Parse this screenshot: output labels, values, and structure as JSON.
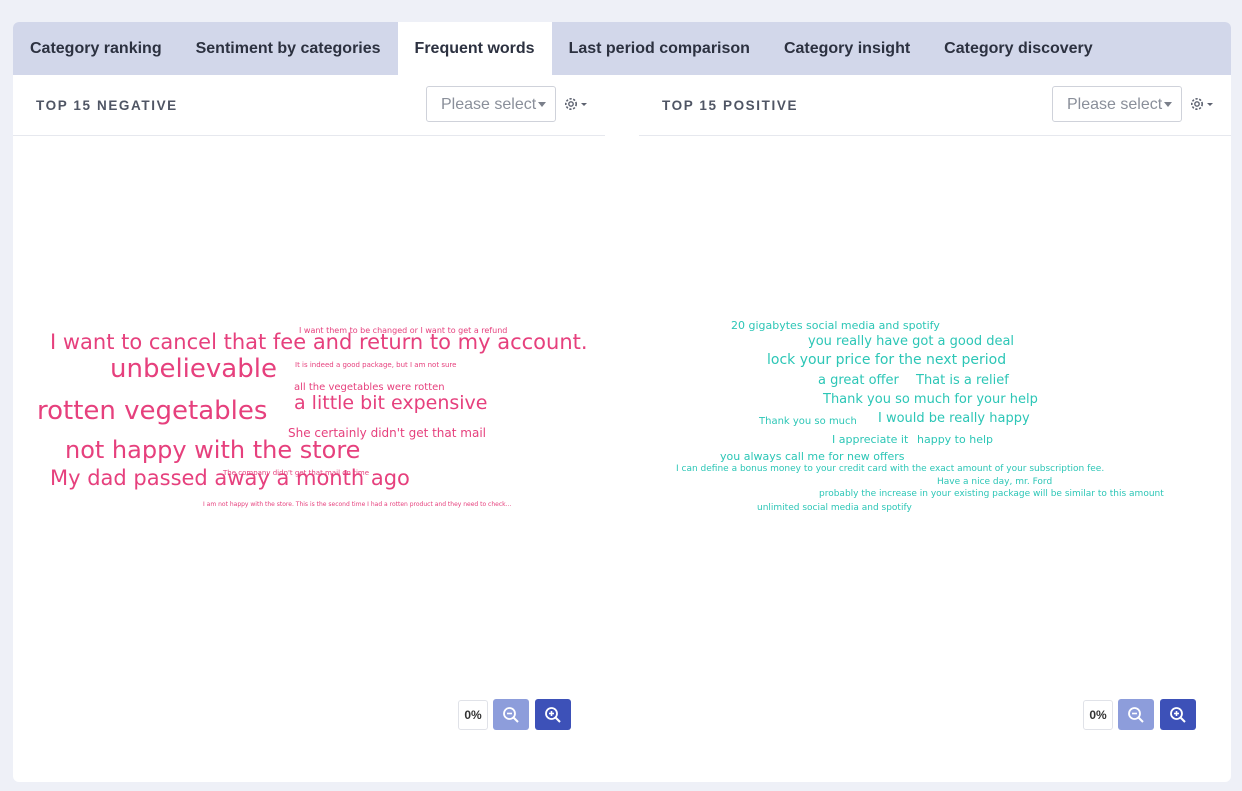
{
  "tabs": [
    {
      "label": "Category ranking"
    },
    {
      "label": "Sentiment by categories"
    },
    {
      "label": "Frequent words",
      "active": true
    },
    {
      "label": "Last period comparison"
    },
    {
      "label": "Category insight"
    },
    {
      "label": "Category discovery"
    }
  ],
  "negative": {
    "title": "TOP 15 NEGATIVE",
    "select_placeholder": "Please select",
    "zoom_level": "0%",
    "color": "#e6407d",
    "words": [
      "I want them to be changed or I want to get a refund",
      "I want to cancel that fee and return to my account.",
      "It is indeed a good package, but I am not sure",
      "unbelievable",
      "all the vegetables were rotten",
      "rotten vegetables",
      "a little bit expensive",
      "She certainly didn't get that mail",
      "not happy with the store",
      "My dad passed away a month ago",
      "The company didn't get that mail on time",
      "I am not happy with the store. This is the second time I had a rotten product and they need to check..."
    ]
  },
  "positive": {
    "title": "TOP 15 POSITIVE",
    "select_placeholder": "Please select",
    "zoom_level": "0%",
    "color": "#2cc6b6",
    "words": [
      "20 gigabytes social media and spotify",
      "you really have got a good deal",
      "lock your price for the next period",
      "a great offer",
      "That is a relief",
      "Thank you so much for your help",
      "Thank you so much",
      "I would be really happy",
      "I appreciate it",
      "happy to help",
      "you always call me for new offers",
      "I can define a bonus money to your credit card with the exact amount of your subscription fee.",
      "Have a nice day, mr. Ford",
      "probably the increase in your existing package will be similar to this amount",
      "unlimited social media and spotify"
    ]
  }
}
